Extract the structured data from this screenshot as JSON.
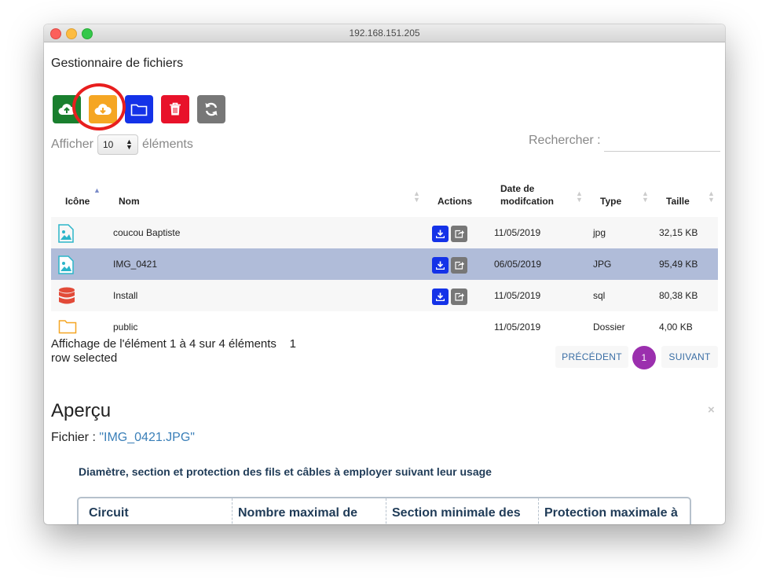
{
  "window": {
    "title": "192.168.151.205"
  },
  "app": {
    "title": "Gestionnaire de fichiers"
  },
  "toolbar": {
    "buttons": [
      {
        "name": "upload",
        "icon": "cloud-upload-icon",
        "color": "#1a7f2e"
      },
      {
        "name": "download",
        "icon": "cloud-download-icon",
        "color": "#f5a623"
      },
      {
        "name": "folder",
        "icon": "folder-icon",
        "color": "#1432e8"
      },
      {
        "name": "delete",
        "icon": "trash-icon",
        "color": "#e8122a"
      },
      {
        "name": "refresh",
        "icon": "refresh-icon",
        "color": "#777777"
      }
    ]
  },
  "length": {
    "prefix": "Afficher",
    "value": "10",
    "suffix": "éléments"
  },
  "search": {
    "label": "Rechercher :",
    "value": ""
  },
  "table": {
    "headers": {
      "icon": "Icône",
      "name": "Nom",
      "actions": "Actions",
      "date_l1": "Date de",
      "date_l2": "modifcation",
      "type": "Type",
      "size": "Taille"
    },
    "rows": [
      {
        "icon": "image-file-icon",
        "name": "coucou Baptiste",
        "date": "11/05/2019",
        "type": "jpg",
        "size": "32,15 KB",
        "actions": true,
        "selected": false
      },
      {
        "icon": "image-file-icon",
        "name": "IMG_0421",
        "date": "06/05/2019",
        "type": "JPG",
        "size": "95,49 KB",
        "actions": true,
        "selected": true
      },
      {
        "icon": "database-icon",
        "name": "Install",
        "date": "11/05/2019",
        "type": "sql",
        "size": "80,38 KB",
        "actions": true,
        "selected": false
      },
      {
        "icon": "folder-outline-icon",
        "name": "public",
        "date": "11/05/2019",
        "type": "Dossier",
        "size": "4,00 KB",
        "actions": false,
        "selected": false
      }
    ]
  },
  "info": {
    "line1": "Affichage de l'élément 1 à 4 sur 4 éléments    1",
    "line2": "row selected"
  },
  "pagination": {
    "prev": "PRÉCÉDENT",
    "current": "1",
    "next": "SUIVANT"
  },
  "preview": {
    "title": "Aperçu",
    "close": "×",
    "file_label": "Fichier : ",
    "file_name": "\"IMG_0421.JPG\"",
    "doc_heading": "Diamètre, section et protection des fils et câbles à employer suivant leur usage",
    "doc_columns": [
      "Circuit",
      "Nombre maximal de",
      "Section minimale des",
      "Protection maximale à"
    ]
  }
}
